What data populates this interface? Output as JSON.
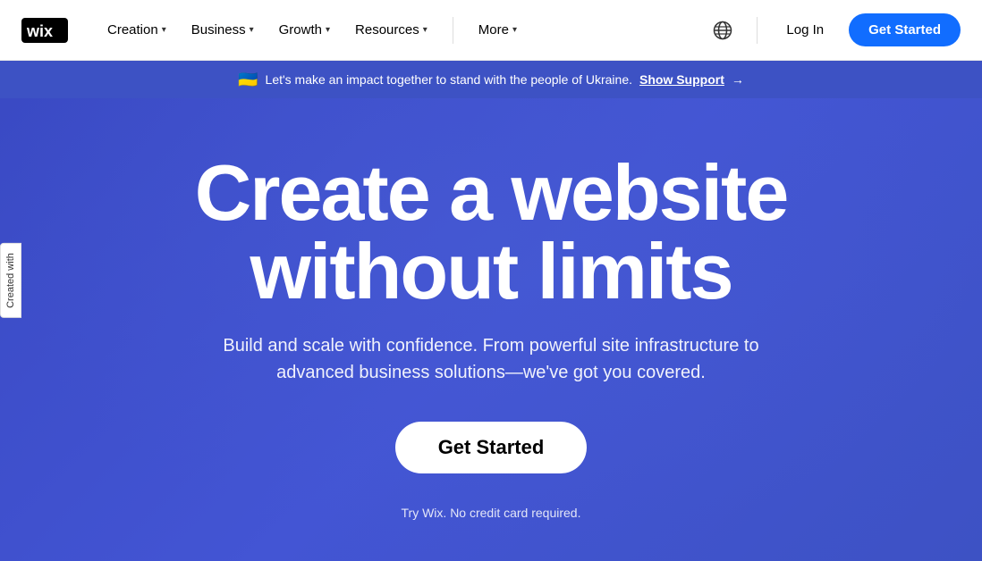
{
  "brand": {
    "name": "Wix",
    "logo_alt": "Wix logo"
  },
  "navbar": {
    "creation_label": "Creation",
    "business_label": "Business",
    "growth_label": "Growth",
    "resources_label": "Resources",
    "more_label": "More",
    "login_label": "Log In",
    "get_started_label": "Get Started"
  },
  "ukraine_banner": {
    "flag_emoji": "🇺🇦",
    "message": "Let's make an impact together to stand with the people of Ukraine.",
    "cta_label": "Show Support",
    "arrow": "→"
  },
  "hero": {
    "title_line1": "Create a website",
    "title_line2": "without limits",
    "subtitle": "Build and scale with confidence. From powerful site infrastructure to advanced business solutions—we've got you covered.",
    "cta_label": "Get Started",
    "disclaimer": "Try Wix. No credit card required."
  },
  "side_tab": {
    "label": "Created with"
  },
  "colors": {
    "hero_bg": "#3a4fc7",
    "banner_bg": "#3a4ac4",
    "cta_blue": "#116dff",
    "white": "#ffffff"
  }
}
